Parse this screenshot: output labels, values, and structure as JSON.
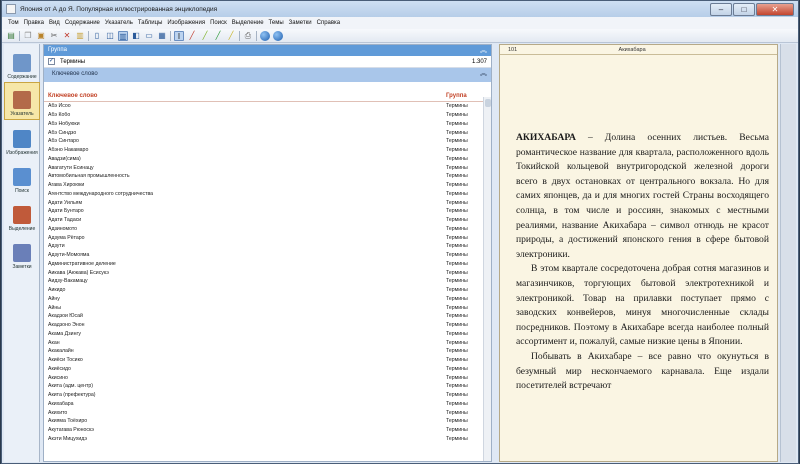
{
  "window": {
    "title": "Япония от А до Я. Популярная иллюстрированная энциклопедия"
  },
  "menu": [
    "Том",
    "Правка",
    "Вид",
    "Содержание",
    "Указатель",
    "Таблицы",
    "Изображения",
    "Поиск",
    "Выделение",
    "Темы",
    "Заметки",
    "Справка"
  ],
  "sidebar": [
    {
      "label": "Содержание",
      "active": false
    },
    {
      "label": "Указатель",
      "active": true
    },
    {
      "label": "Изображения",
      "active": false
    },
    {
      "label": "Поиск",
      "active": false
    },
    {
      "label": "Выделение",
      "active": false
    },
    {
      "label": "Заметки",
      "active": false
    }
  ],
  "list": {
    "group_header": "Группа",
    "group_row": {
      "name": "Термины",
      "count": "1.307",
      "checked": true
    },
    "keyword_header": "Ключевое слово",
    "col_keyword": "Ключевое слово",
    "col_group": "Группа",
    "selected_index": 39,
    "rows": [
      {
        "k": "Абэ Исоо",
        "g": "Термины"
      },
      {
        "k": "Абэ Кобо",
        "g": "Термины"
      },
      {
        "k": "Абэ Нобуюки",
        "g": "Термины"
      },
      {
        "k": "Абэ Синдзо",
        "g": "Термины"
      },
      {
        "k": "Абэ Синтаро",
        "g": "Термины"
      },
      {
        "k": "Абэно Накамаро",
        "g": "Термины"
      },
      {
        "k": "Авадзи(сима)",
        "g": "Термины"
      },
      {
        "k": "Авагатути Есинацу",
        "g": "Термины"
      },
      {
        "k": "Автомобильная промышленность",
        "g": "Термины"
      },
      {
        "k": "Агава Хироюки",
        "g": "Термины"
      },
      {
        "k": "Агентство международного сотрудничества",
        "g": "Термины"
      },
      {
        "k": "Адати Уильям",
        "g": "Термины"
      },
      {
        "k": "Адати Бунтаро",
        "g": "Термины"
      },
      {
        "k": "Адати Тадаси",
        "g": "Термины"
      },
      {
        "k": "Адзиномото",
        "g": "Термины"
      },
      {
        "k": "Адзума Рётаро",
        "g": "Термины"
      },
      {
        "k": "Адзути",
        "g": "Термины"
      },
      {
        "k": "Адзути-Момояма",
        "g": "Термины"
      },
      {
        "k": "Административное деление",
        "g": "Термины"
      },
      {
        "k": "Аикава (Аюкава) Ёсисукэ",
        "g": "Термины"
      },
      {
        "k": "Аидзу-Вакамацу",
        "g": "Термины"
      },
      {
        "k": "Аикидо",
        "g": "Термины"
      },
      {
        "k": "Айну",
        "g": "Термины"
      },
      {
        "k": "Айны",
        "g": "Термины"
      },
      {
        "k": "Акадзои Юсай",
        "g": "Термины"
      },
      {
        "k": "Акадзоно Энон",
        "g": "Термины"
      },
      {
        "k": "Акама Дзингу",
        "g": "Термины"
      },
      {
        "k": "Акан",
        "g": "Термины"
      },
      {
        "k": "Акакалайн",
        "g": "Термины"
      },
      {
        "k": "Акиёси Тосико",
        "g": "Термины"
      },
      {
        "k": "Акиёсидо",
        "g": "Термины"
      },
      {
        "k": "Акисино",
        "g": "Термины"
      },
      {
        "k": "Акита (адм. центр)",
        "g": "Термины"
      },
      {
        "k": "Акита (префектура)",
        "g": "Термины"
      },
      {
        "k": "Акихабара",
        "g": "Термины"
      },
      {
        "k": "Акихито",
        "g": "Термины"
      },
      {
        "k": "Акияма Тоёхиро",
        "g": "Термины"
      },
      {
        "k": "Акутагава Рюноскэ",
        "g": "Термины"
      },
      {
        "k": "Акэти Мицухидэ",
        "g": "Термины"
      }
    ]
  },
  "article": {
    "page_number": "101",
    "page_title": "Акихабара",
    "headword": "АКИХАБАРА",
    "p1": " – Долина осенних листьев. Весьма романтическое название для квартала, расположенного вдоль Токийской кольцевой внутригородской железной дороги всего в двух остановках от центрального вокзала. Но для самих японцев, да и для многих гостей Страны восходящего солнца, в том числе и россиян, знакомых с местными реалиями, название Акихабара – символ отнюдь не красот природы, а достижений японского гения в сфере бытовой электроники.",
    "p2": "В этом квартале сосредоточена добрая сотня магазинов и магазинчиков, торгующих бытовой электротехникой и электроникой. Товар на прилавки поступает прямо с заводских конвейеров, минуя многочисленные склады посредников. Поэтому в Акихабаре всегда наиболее полный ассортимент и, пожалуй, самые низкие цены в Японии.",
    "p3": "Побывать в Акихабаре – все равно что окунуться в безумный мир нескончаемого карнавала. Еще издали посетителей встречают"
  },
  "colors": {
    "selection": "#3a86d8",
    "accent": "#c24125",
    "group_header": "#5f9ad8"
  }
}
